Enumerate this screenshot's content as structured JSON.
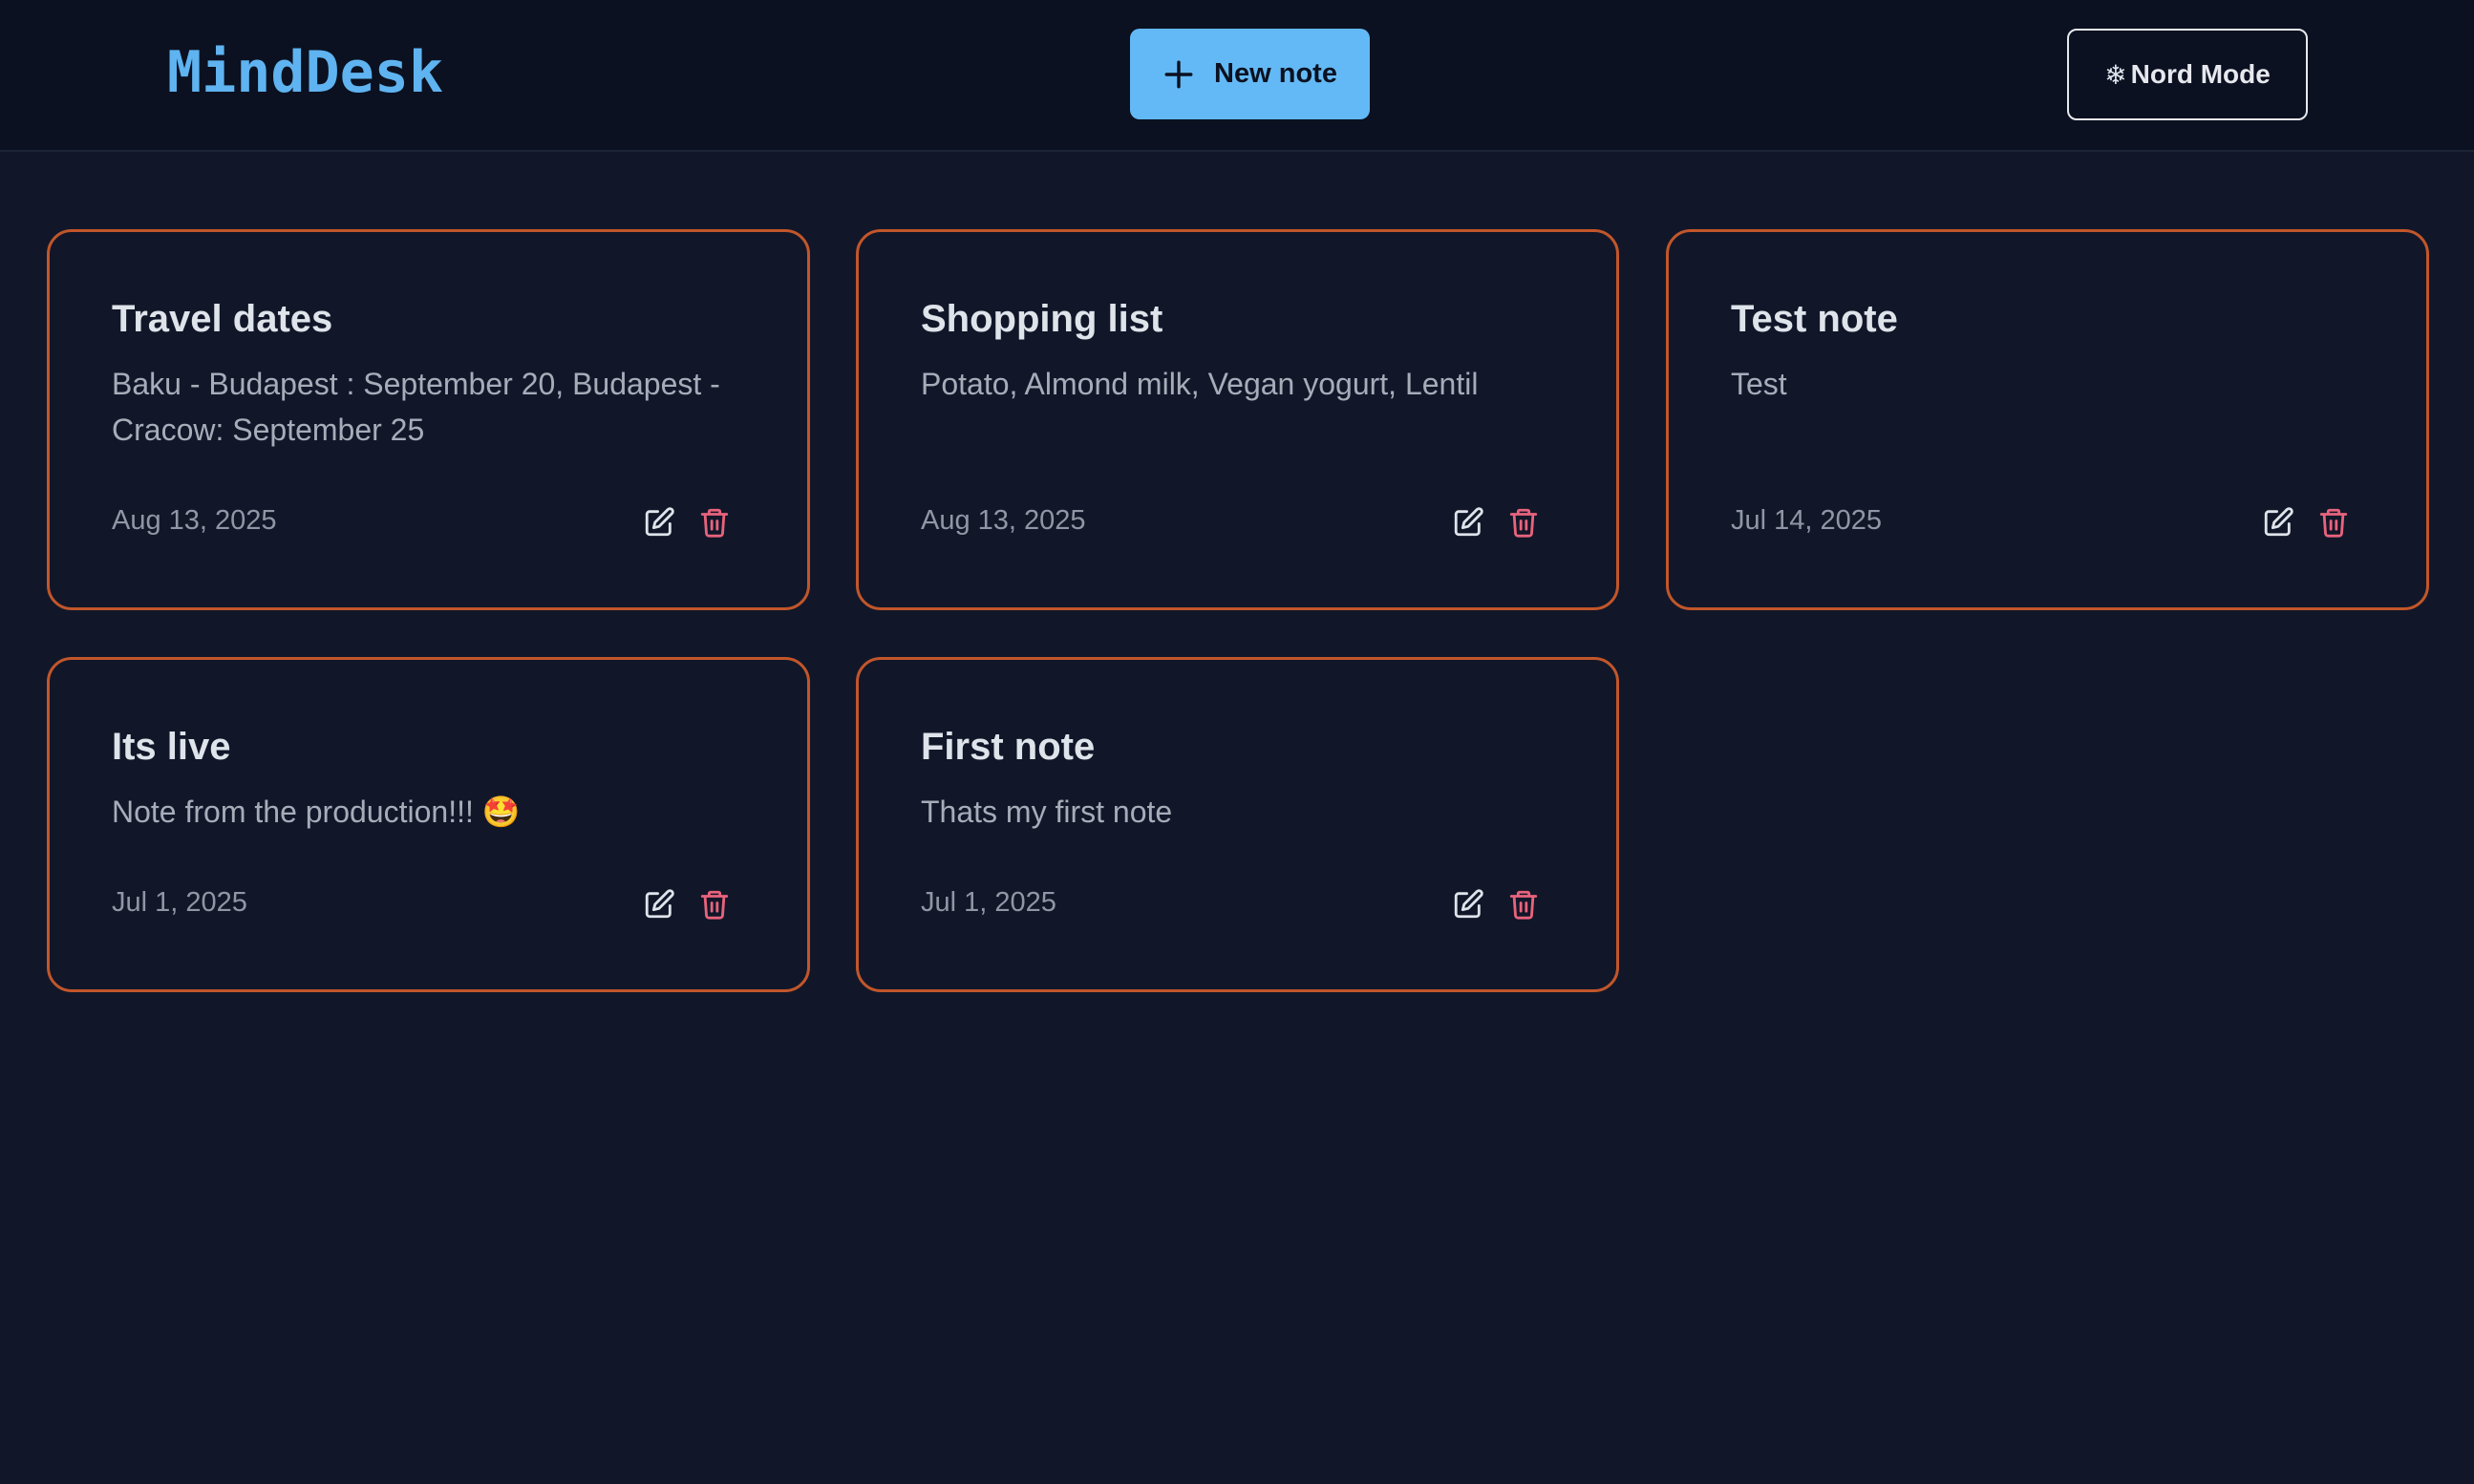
{
  "app": {
    "title": "MindDesk"
  },
  "header": {
    "new_note_label": "New note",
    "theme_label": "Nord Mode",
    "theme_glyph": "❄",
    "new_note_icon": "plus-icon",
    "theme_icon": "snowflake-icon"
  },
  "colors": {
    "background": "#111729",
    "topbar": "#0b1120",
    "accent": "#63b9f5",
    "logo": "#5fb3f0",
    "card_border": "#c2562a",
    "delete": "#e8637d"
  },
  "notes": [
    {
      "title": "Travel dates",
      "body": "Baku - Budapest : September 20, Budapest - Cracow: September 25",
      "date": "Aug 13, 2025"
    },
    {
      "title": "Shopping list",
      "body": "Potato, Almond milk, Vegan yogurt, Lentil",
      "date": "Aug 13, 2025"
    },
    {
      "title": "Test note",
      "body": "Test",
      "date": "Jul 14, 2025"
    },
    {
      "title": "Its live",
      "body": "Note from the production!!! 🤩",
      "date": "Jul 1, 2025"
    },
    {
      "title": "First note",
      "body": "Thats my first note",
      "date": "Jul 1, 2025"
    }
  ]
}
